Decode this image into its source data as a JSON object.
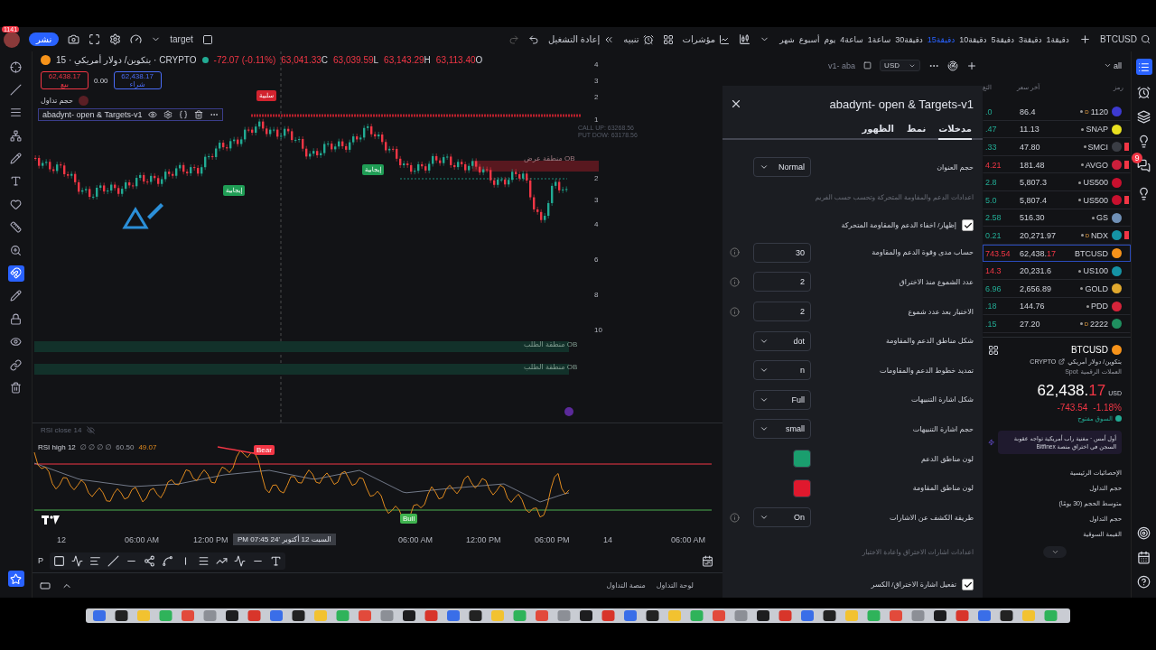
{
  "system": {
    "badge": "1141"
  },
  "header": {
    "publish": "نشر",
    "layout_name": "target",
    "replay": "إعادة التشغيل",
    "alert": "تنبيه",
    "indicators": "مؤشرات",
    "symbol": "BTCUSD",
    "intervals": [
      {
        "label": "1دقيقة",
        "selected": false
      },
      {
        "label": "3دقيقة",
        "selected": false
      },
      {
        "label": "5دقيقة",
        "selected": false
      },
      {
        "label": "10دقيقة",
        "selected": false
      },
      {
        "label": "15دقيقة",
        "selected": true
      },
      {
        "label": "30دقيقة",
        "selected": false
      },
      {
        "label": "1ساعة",
        "selected": false
      },
      {
        "label": "4ساعة",
        "selected": false
      },
      {
        "label": "يوم",
        "selected": false
      },
      {
        "label": "أسبوع",
        "selected": false
      },
      {
        "label": "شهر",
        "selected": false
      }
    ]
  },
  "chart": {
    "legend": {
      "title": "بتكوين/ دولار أمريكي · 15 · CRYPTO",
      "change": "-72.07 (-0.11%)",
      "ohlc": [
        {
          "label": "O",
          "value": "63,113.40"
        },
        {
          "label": "H",
          "value": "63,143.29"
        },
        {
          "label": "L",
          "value": "63,039.59"
        },
        {
          "label": "C",
          "value": "63,041.33"
        }
      ]
    },
    "sell": {
      "price": "62,438.17",
      "label": "بيع"
    },
    "spread": "0.00",
    "buy": {
      "price": "62,438.17",
      "label": "شراء"
    },
    "volume_label": "حجم تداول",
    "indicator": "abadynt- open & Targets-v1",
    "top_right": {
      "name": "v1- aba",
      "currency": "USD"
    },
    "markers": [
      {
        "kind": "bear",
        "label": "سلبية"
      },
      {
        "kind": "bull",
        "label": "إيجابية"
      },
      {
        "kind": "bull",
        "label": "إيجابية"
      }
    ],
    "zones": [
      {
        "kind": "supply",
        "label": "منطقة عرض",
        "tag": "OB"
      },
      {
        "kind": "demand",
        "label": "منطقة الطلب",
        "tag": "OB"
      },
      {
        "kind": "demand",
        "label": "منطقة الطلب",
        "tag": "OB"
      }
    ],
    "notes": [
      "CALL UP: 63268.56",
      "PUT DOW: 63178.56"
    ],
    "scale": [
      "4",
      "3",
      "2",
      "1",
      "2",
      "3",
      "4",
      "6",
      "8",
      "10"
    ],
    "rsi": {
      "title": "RSI close 14",
      "name": "RSI high 12",
      "params": "∅ ∅ ∅ ∅",
      "value": "60.50",
      "rsi_value": "49.07",
      "bear": "Bear",
      "bull": "Bull"
    },
    "time_axis": [
      "06:00 AM",
      "14",
      "06:00 PM",
      "12:00 PM",
      "06:00 AM",
      "12:00 PM",
      "06:00 AM",
      "12"
    ],
    "crosshair_time": "السبت 12 أكتوبر '24  07:45 PM",
    "toolbar_letter": "P",
    "bottom_tabs": [
      "لوحة التداول",
      "منصة التداول"
    ]
  },
  "dialog": {
    "title": "abadynt- open & Targets-v1",
    "tabs": [
      {
        "label": "مدخلات",
        "selected": true
      },
      {
        "label": "نمط",
        "selected": false
      },
      {
        "label": "الظهور",
        "selected": false
      }
    ],
    "rows": [
      {
        "kind": "select",
        "label": "حجم العنوان",
        "value": "Normal",
        "info": false
      },
      {
        "kind": "section",
        "label": "اعدادات الدعم والمقاومة المتحركة وتحسب حسب الفريم"
      },
      {
        "kind": "checkbox",
        "label": "إظهار/ اخفاء الدعم والمقاومة المتحركة",
        "checked": true
      },
      {
        "kind": "number",
        "label": "حساب مدى وقوة الدعم والمقاومة",
        "value": "30",
        "info": true
      },
      {
        "kind": "number",
        "label": "عدد الشموع منذ الاختراق",
        "value": "2",
        "info": true
      },
      {
        "kind": "number",
        "label": "الاختبار بعد عدد شموع",
        "value": "2",
        "info": true
      },
      {
        "kind": "select",
        "label": "شكل مناطق الدعم والمقاومة",
        "value": "dot",
        "info": false
      },
      {
        "kind": "select",
        "label": "تمديد خطوط الدعم والمقاومات",
        "value": "n",
        "info": false
      },
      {
        "kind": "select",
        "label": "شكل اشارة التنبيهات",
        "value": "Full",
        "info": false
      },
      {
        "kind": "select",
        "label": "حجم اشارة التنبيهات",
        "value": "small",
        "info": false
      },
      {
        "kind": "color",
        "label": "لون مناطق الدعم",
        "color": "#1a9e6e",
        "info": false
      },
      {
        "kind": "color",
        "label": "لون مناطق المقاومة",
        "color": "#e0182d",
        "info": false
      },
      {
        "kind": "select",
        "label": "طريقة الكشف عن الاشارات",
        "value": "On",
        "info": true
      },
      {
        "kind": "section",
        "label": "اعدادات اشارات الاختراق واعادة الاختبار"
      },
      {
        "kind": "checkbox",
        "label": "تفعيل اشارة الاختراق/ الكسر",
        "checked": true
      }
    ]
  },
  "watchlist": {
    "filter": "all",
    "columns": [
      "رمز",
      "آخر سعر",
      "التغ"
    ],
    "rows": [
      {
        "symbol": "1120",
        "price": "86.4",
        "change": ".0",
        "negative": false,
        "color": "#3d3ad1",
        "badge": "D",
        "dot": true,
        "flagged": false,
        "selected": false
      },
      {
        "symbol": "SNAP",
        "price": "11.13",
        "change": ".47",
        "negative": false,
        "color": "#e8e020",
        "dot": true,
        "flagged": false,
        "selected": false
      },
      {
        "symbol": "SMCI",
        "price": "47.80",
        "change": ".33",
        "negative": false,
        "color": "#3a3d44",
        "dot": true,
        "flagged": true,
        "selected": false
      },
      {
        "symbol": "AVGO",
        "price": "181.48",
        "change": "4.21",
        "negative": true,
        "color": "#cc1f3b",
        "dot": true,
        "flagged": true,
        "selected": false
      },
      {
        "symbol": "US500",
        "price": "5,807.3",
        "change": "2.8",
        "negative": false,
        "color": "#c8102e",
        "dot": true,
        "flagged": false,
        "selected": false
      },
      {
        "symbol": "US500",
        "price": "5,807.4",
        "change": "5.0",
        "negative": false,
        "color": "#c8102e",
        "dot": true,
        "flagged": true,
        "selected": false
      },
      {
        "symbol": "GS",
        "price": "516.30",
        "change": "2.58",
        "negative": false,
        "color": "#6f8fb5",
        "dot": true,
        "flagged": false,
        "selected": false
      },
      {
        "symbol": "NDX",
        "price": "20,271.97",
        "change": "0.21",
        "negative": false,
        "color": "#1593a5",
        "badge": "D",
        "dot": true,
        "flagged": true,
        "selected": false
      },
      {
        "symbol": "BTCUSD",
        "price": "62,438.",
        "price_tail": "17",
        "change": "743.54",
        "negative": true,
        "color": "#f7931a",
        "dot": false,
        "flagged": false,
        "selected": true
      },
      {
        "symbol": "US100",
        "price": "20,231.6",
        "change": "14.3",
        "negative": true,
        "color": "#1593a5",
        "dot": true,
        "flagged": false,
        "selected": false
      },
      {
        "symbol": "GOLD",
        "price": "2,656.89",
        "change": "6.96",
        "negative": false,
        "color": "#e0a82e",
        "dot": true,
        "flagged": false,
        "selected": false
      },
      {
        "symbol": "PDD",
        "price": "144.76",
        "change": ".18",
        "negative": false,
        "color": "#d6243a",
        "dot": true,
        "flagged": false,
        "selected": false
      },
      {
        "symbol": "2222",
        "price": "27.20",
        "change": ".15",
        "negative": false,
        "color": "#1f8f5f",
        "badge": "D",
        "dot": true,
        "flagged": false,
        "selected": false
      }
    ]
  },
  "details": {
    "symbol": "BTCUSD",
    "name": "بتكوين/ دولار أمريكي",
    "exchange": "CRYPTO",
    "type": "Spot",
    "category": "العملات الرقمية",
    "price": "62,438.",
    "price_tail": "17",
    "currency": "USD",
    "change": "-743.54",
    "change_pct": "-1.18%",
    "market": "السوق مفتوح",
    "news": "أول أمس · مغنية راب أمريكية تواجه عقوبة السجن في اختراق منصة Bitfinex",
    "stats_title": "الإحصائيات الرئيسية",
    "stats": [
      "حجم التداول",
      "متوسط الحجم (30 يومًا)",
      "حجم التداول",
      "القيمة السوقية"
    ]
  },
  "right_rail": {
    "chat_badge": "9"
  }
}
